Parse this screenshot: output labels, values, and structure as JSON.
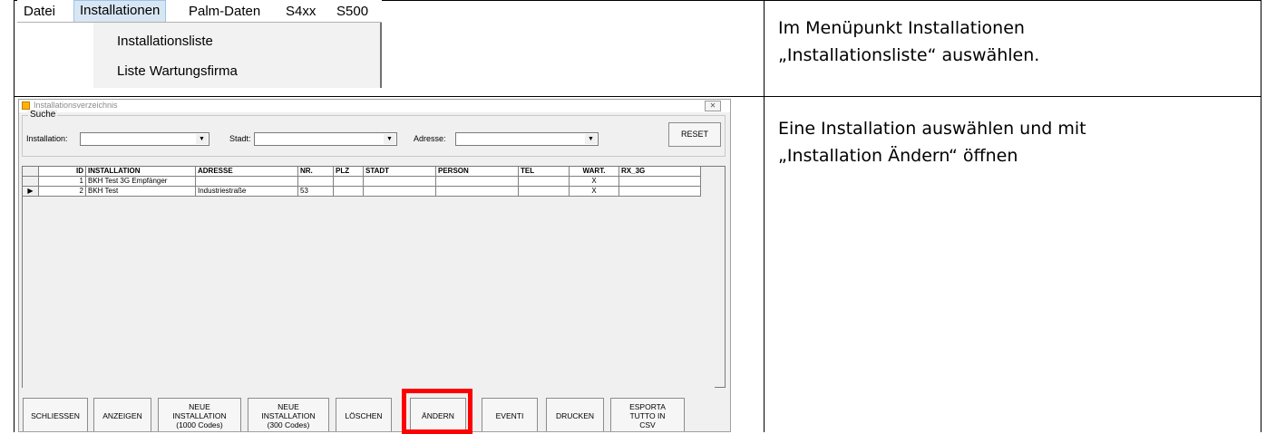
{
  "instructions": {
    "step1_line1": "Im Menüpunkt Installationen",
    "step1_line2": "„Installationsliste“ auswählen.",
    "step2_line1": "Eine Installation auswählen und mit",
    "step2_line2": "„Installation Ändern“ öffnen"
  },
  "menu": {
    "items": [
      "Datei",
      "Installationen",
      "Palm-Daten",
      "S4xx",
      "S500"
    ],
    "active_index": 1,
    "dropdown": [
      "Installationsliste",
      "Liste Wartungsfirma"
    ]
  },
  "dialog": {
    "title": "Installationsverzeichnis",
    "close": "✕",
    "search_group": "Suche",
    "installation_label": "Installation:",
    "stadt_label": "Stadt:",
    "adresse_label": "Adresse:",
    "reset_label": "RESET"
  },
  "table": {
    "columns": [
      "ID",
      "INSTALLATION",
      "ADRESSE",
      "NR.",
      "PLZ",
      "STADT",
      "PERSON",
      "TEL",
      "WART.",
      "RX_3G"
    ],
    "rows": [
      {
        "indicator": "",
        "id": "1",
        "installation": "BKH Test 3G Empfänger",
        "adresse": "",
        "nr": "",
        "plz": "",
        "stadt": "",
        "person": "",
        "tel": "",
        "wart": "X",
        "rx3g": ""
      },
      {
        "indicator": "▶",
        "id": "2",
        "installation": "BKH Test",
        "adresse": "Industriestraße",
        "nr": "53",
        "plz": "",
        "stadt": "",
        "person": "",
        "tel": "",
        "wart": "X",
        "rx3g": ""
      }
    ]
  },
  "buttons": {
    "schliessen": "SCHLIESSEN",
    "anzeigen": "ANZEIGEN",
    "neue_1000": "NEUE\nINSTALLATION\n(1000 Codes)",
    "neue_300": "NEUE\nINSTALLATION\n(300 Codes)",
    "loeschen": "LÖSCHEN",
    "aendern": "ÄNDERN",
    "eventi": "EVENTI",
    "drucken": "DRUCKEN",
    "esporta": "ESPORTA\nTUTTO IN\nCSV"
  },
  "colors": {
    "highlight": "#ff0000",
    "menu_active": "#d8e6f4"
  }
}
